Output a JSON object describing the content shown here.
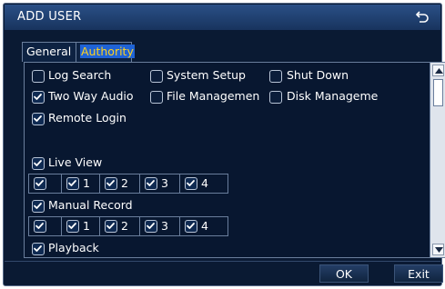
{
  "window": {
    "title": "ADD USER",
    "back_icon": "return-arrow-icon"
  },
  "tabs": [
    {
      "label": "General",
      "active": false
    },
    {
      "label": "Authority",
      "active": true
    }
  ],
  "permissions": {
    "log_search": {
      "label": "Log Search",
      "checked": false
    },
    "system_setup": {
      "label": "System Setup",
      "checked": false
    },
    "shut_down": {
      "label": "Shut Down",
      "checked": false
    },
    "two_way_audio": {
      "label": "Two Way Audio",
      "checked": true
    },
    "file_management": {
      "label": "File Managemen",
      "checked": false
    },
    "disk_management": {
      "label": "Disk Manageme",
      "checked": false
    },
    "remote_login": {
      "label": "Remote Login",
      "checked": true
    }
  },
  "live_view": {
    "label": "Live View",
    "checked": true,
    "channels": [
      {
        "label": "",
        "checked": true
      },
      {
        "label": "1",
        "checked": true
      },
      {
        "label": "2",
        "checked": true
      },
      {
        "label": "3",
        "checked": true
      },
      {
        "label": "4",
        "checked": true
      }
    ]
  },
  "manual_record": {
    "label": "Manual Record",
    "checked": true,
    "channels": [
      {
        "label": "",
        "checked": true
      },
      {
        "label": "1",
        "checked": true
      },
      {
        "label": "2",
        "checked": true
      },
      {
        "label": "3",
        "checked": true
      },
      {
        "label": "4",
        "checked": true
      }
    ]
  },
  "playback": {
    "label": "Playback",
    "checked": true
  },
  "buttons": {
    "ok": "OK",
    "exit": "Exit"
  }
}
